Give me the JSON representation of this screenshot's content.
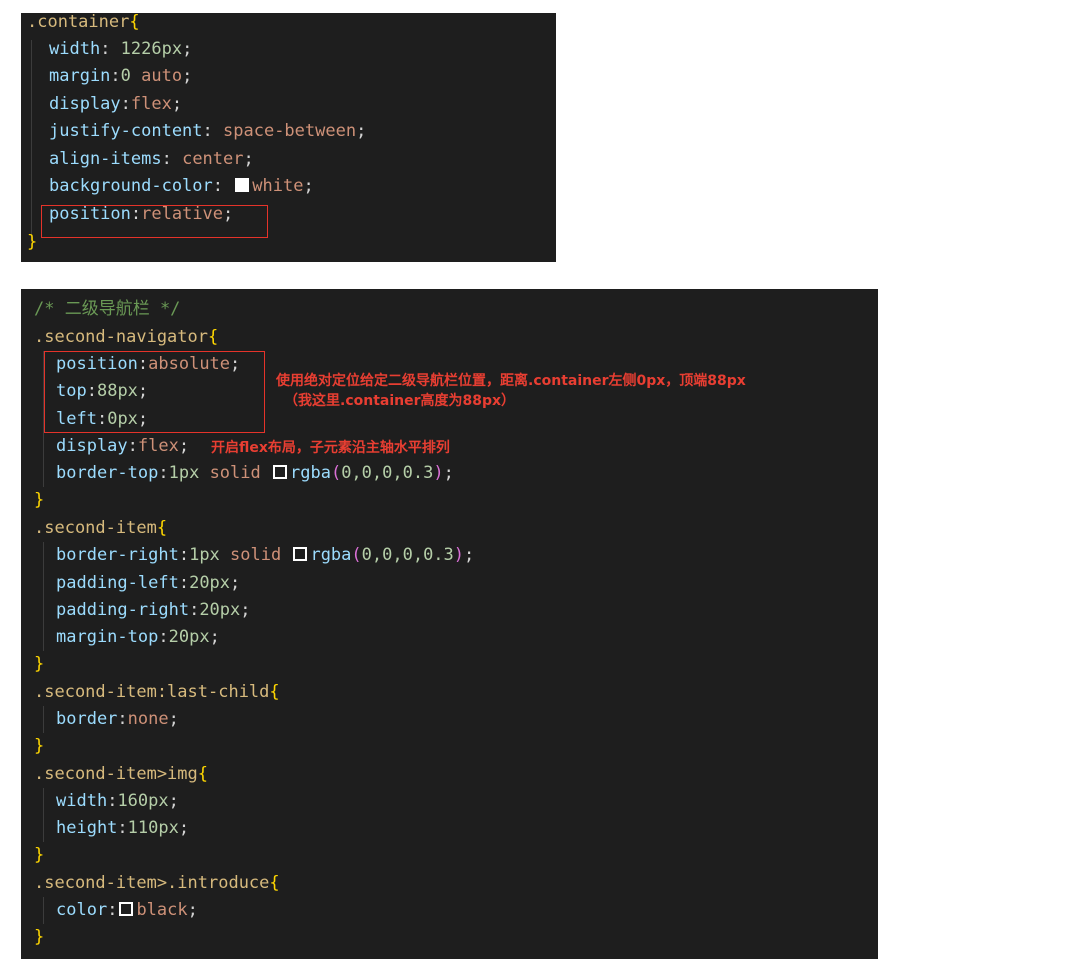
{
  "block1": {
    "selector": ".container",
    "open_brace": "{",
    "close_brace": "}",
    "decls": [
      {
        "prop": "width",
        "sep": ": ",
        "num": "1226px",
        "val": ""
      },
      {
        "prop": "margin",
        "sep": ":",
        "num": "0",
        "val": " auto"
      },
      {
        "prop": "display",
        "sep": ":",
        "num": "",
        "val": "flex"
      },
      {
        "prop": "justify-content",
        "sep": ": ",
        "num": "",
        "val": "space-between"
      },
      {
        "prop": "align-items",
        "sep": ": ",
        "num": "",
        "val": "center"
      },
      {
        "prop": "background-color",
        "sep": ": ",
        "num": "",
        "val": "white"
      },
      {
        "prop": "position",
        "sep": ":",
        "num": "",
        "val": "relative"
      }
    ],
    "swatch_color": "#ffffff"
  },
  "block2": {
    "comment": "/* 二级导航栏 */",
    "rules": [
      {
        "selector": ".second-navigator",
        "decls": [
          {
            "prop": "position",
            "sep": ":",
            "val": "absolute"
          },
          {
            "prop": "top",
            "sep": ":",
            "num": "88px"
          },
          {
            "prop": "left",
            "sep": ":",
            "num": "0px"
          },
          {
            "prop": "display",
            "sep": ":",
            "val": "flex"
          },
          {
            "prop": "border-top",
            "sep": ":",
            "num": "1px",
            "val": " solid ",
            "fn": "rgba",
            "args": "0,0,0,0.3"
          }
        ]
      },
      {
        "selector": ".second-item",
        "decls": [
          {
            "prop": "border-right",
            "sep": ":",
            "num": "1px",
            "val": " solid ",
            "fn": "rgba",
            "args": "0,0,0,0.3"
          },
          {
            "prop": "padding-left",
            "sep": ":",
            "num": "20px"
          },
          {
            "prop": "padding-right",
            "sep": ":",
            "num": "20px"
          },
          {
            "prop": "margin-top",
            "sep": ":",
            "num": "20px"
          }
        ]
      },
      {
        "selector": ".second-item:last-child",
        "decls": [
          {
            "prop": "border",
            "sep": ":",
            "val": "none"
          }
        ]
      },
      {
        "selector": ".second-item>img",
        "decls": [
          {
            "prop": "width",
            "sep": ":",
            "num": "160px"
          },
          {
            "prop": "height",
            "sep": ":",
            "num": "110px"
          }
        ]
      },
      {
        "selector": ".second-item>.introduce",
        "decls": [
          {
            "prop": "color",
            "sep": ":",
            "val": "black"
          }
        ]
      }
    ]
  },
  "annotations": {
    "note1_line1": "使用绝对定位给定二级导航栏位置，距离.container左侧0px，顶端88px",
    "note1_line2": "（我这里.container高度为88px）",
    "note2": "开启flex布局，子元素沿主轴水平排列"
  },
  "colors": {
    "panel_bg": "#1e1e1e",
    "annotation_red": "#e83e32"
  }
}
